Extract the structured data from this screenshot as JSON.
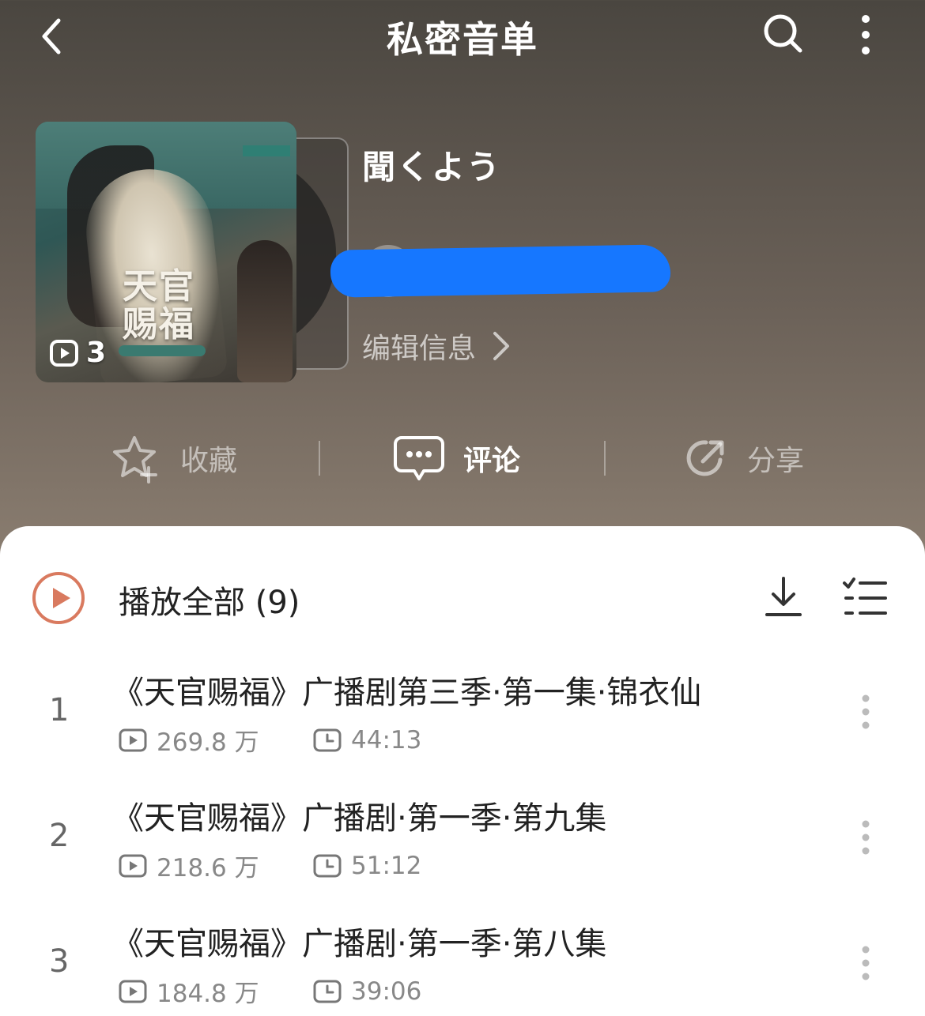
{
  "header": {
    "title": "私密音单"
  },
  "playlist": {
    "cover_title": "天官\n赐福",
    "cover_play_count": "3",
    "name": "聞くよう",
    "edit_label": "编辑信息"
  },
  "actions": {
    "collect_label": "收藏",
    "comment_label": "评论",
    "share_label": "分享"
  },
  "list_header": {
    "play_all_label": "播放全部 (9)"
  },
  "tracks": [
    {
      "index": "1",
      "title": "《天官赐福》广播剧第三季·第一集·锦衣仙",
      "plays": "269.8 万",
      "duration": "44:13"
    },
    {
      "index": "2",
      "title": "《天官赐福》广播剧·第一季·第九集",
      "plays": "218.6 万",
      "duration": "51:12"
    },
    {
      "index": "3",
      "title": "《天官赐福》广播剧·第一季·第八集",
      "plays": "184.8 万",
      "duration": "39:06"
    }
  ],
  "colors": {
    "accent": "#d97a5f",
    "redaction": "#1677ff"
  },
  "icons": [
    "back-icon",
    "search-icon",
    "more-vertical-icon",
    "play-count-icon",
    "chevron-right-icon",
    "star-plus-icon",
    "comment-icon",
    "share-icon",
    "play-circle-icon",
    "download-icon",
    "multi-select-icon",
    "clock-icon"
  ]
}
